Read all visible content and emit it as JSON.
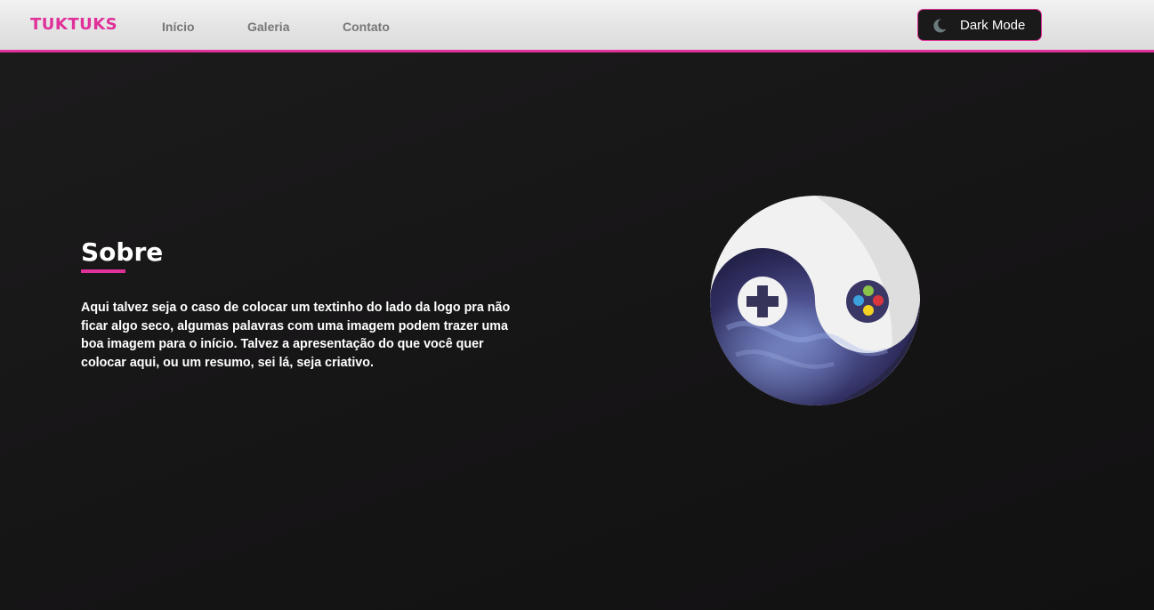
{
  "header": {
    "logo": "TUKTUKS",
    "nav": [
      {
        "label": "Início"
      },
      {
        "label": "Galeria"
      },
      {
        "label": "Contato"
      }
    ],
    "theme_toggle": {
      "label": "Dark Mode",
      "icon": "moon-icon"
    }
  },
  "about": {
    "title": "Sobre",
    "text": "Aqui talvez seja o caso de colocar um textinho do lado da logo pra não ficar algo seco, algumas palavras com uma imagem podem trazer uma boa imagem para o início. Talvez a apresentação do que você quer colocar aqui, ou um resumo, sei lá, seja criativo."
  },
  "hero": {
    "image": "yin-yang-gamepad-logo"
  },
  "colors": {
    "accent": "#e0309a",
    "background": "#161516",
    "header": "#e4e4e4",
    "nav_text": "#777777",
    "controller_dark": "#37345a",
    "button_green": "#8bc34a",
    "button_red": "#d9363e",
    "button_blue": "#3ba0dc",
    "button_yellow": "#f5d222"
  }
}
